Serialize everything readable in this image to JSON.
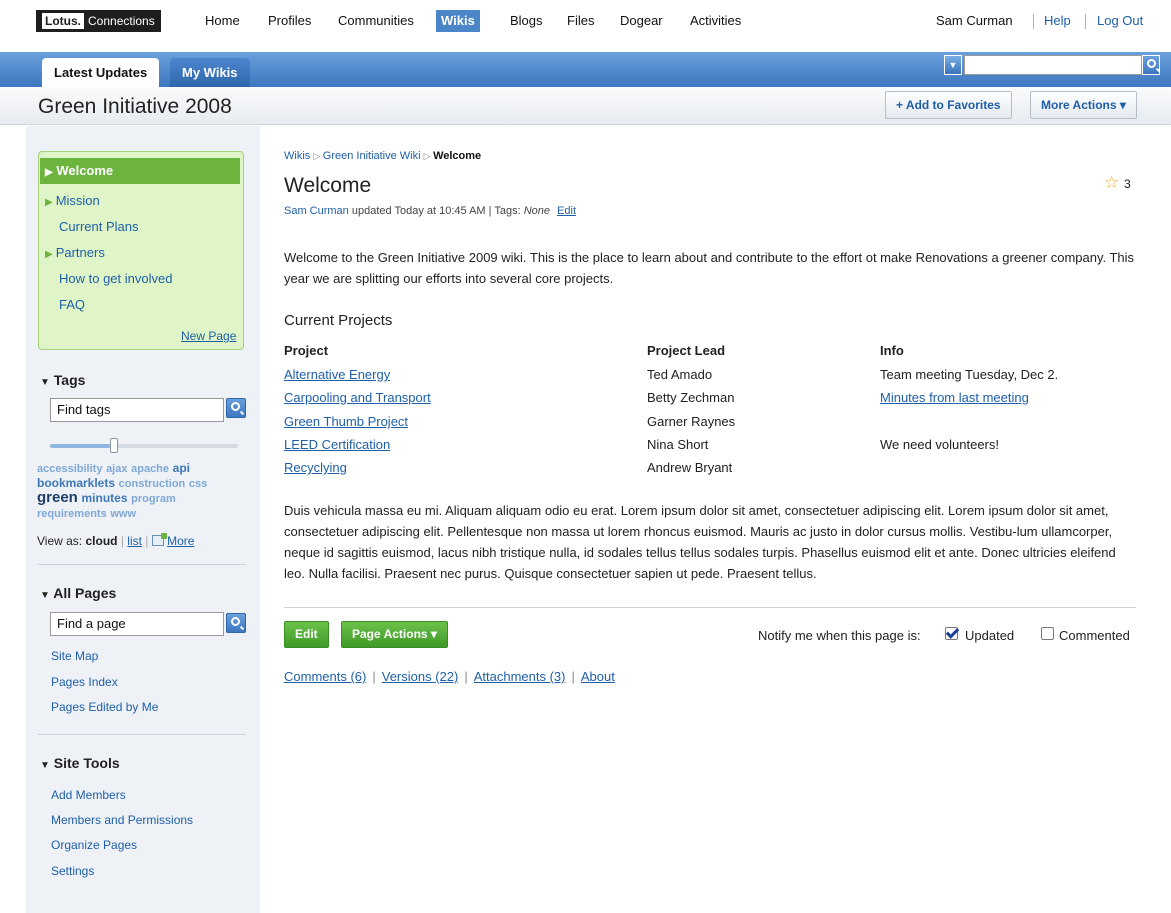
{
  "topnav": {
    "logo_bold": "Lotus.",
    "logo_text": "Connections",
    "items": [
      "Home",
      "Profiles",
      "Communities",
      "Wikis",
      "Blogs",
      "Files",
      "Dogear",
      "Activities"
    ],
    "user": "Sam Curman",
    "help": "Help",
    "logout": "Log Out"
  },
  "tabs": {
    "latest": "Latest Updates",
    "mywikis": "My Wikis"
  },
  "search": {
    "placeholder": "",
    "scope_icon": "chevron-down-icon",
    "button_icon": "search-icon"
  },
  "titlebar": {
    "title": "Green Initiative 2008",
    "add_favorites": "+ Add to Favorites",
    "more_actions": "More Actions ▾"
  },
  "sidebar": {
    "nav": {
      "welcome": "Welcome",
      "items": [
        "Mission",
        "Current Plans",
        "Partners",
        "How to get involved",
        "FAQ"
      ],
      "new_page": "New Page"
    },
    "tags": {
      "title": "Tags",
      "input_value": "Find tags",
      "slider_level": 0.32,
      "cloud": {
        "accessibility": "accessibility",
        "ajax": "ajax",
        "apache": "apache",
        "api": "api",
        "bookmarklets": "bookmarklets",
        "construction": "construction",
        "css": "css",
        "green": "green",
        "minutes": "minutes",
        "program": "program",
        "requirements": "requirements",
        "www": "www"
      },
      "view_as": "View as:",
      "cloud_label": "cloud",
      "list_label": "list",
      "more_label": "More"
    },
    "all_pages": {
      "title": "All Pages",
      "input_value": "Find a page",
      "links": [
        "Site Map",
        "Pages Index",
        "Pages Edited by Me"
      ]
    },
    "site_tools": {
      "title": "Site Tools",
      "links": [
        "Add Members",
        "Members and Permissions",
        "Organize Pages",
        "Settings"
      ]
    }
  },
  "main": {
    "breadcrumb": {
      "wikis": "Wikis",
      "wiki": "Green Initiative Wiki",
      "current": "Welcome"
    },
    "title": "Welcome",
    "star_count": "3",
    "byline": {
      "author": "Sam Curman",
      "text": " updated Today at 10:45 AM | Tags: ",
      "tags": "None",
      "edit": "Edit"
    },
    "intro": "Welcome to the Green Initiative 2009 wiki. This is the place to learn about and contribute to the effort ot make Renovations a greener company.  This year we are splitting our efforts into several core projects.",
    "projects_heading": "Current Projects",
    "table": {
      "headers": [
        "Project",
        "Project Lead",
        "Info"
      ],
      "rows": [
        {
          "project": "Alternative Energy",
          "lead": "Ted Amado",
          "info": "Team meeting Tuesday, Dec 2.",
          "info_link": false
        },
        {
          "project": "Carpooling and Transport",
          "lead": "Betty Zechman",
          "info": "Minutes from last meeting",
          "info_link": true
        },
        {
          "project": "Green Thumb Project",
          "lead": "Garner Raynes",
          "info": "",
          "info_link": false
        },
        {
          "project": "LEED Certification",
          "lead": "Nina Short",
          "info": "We need volunteers!",
          "info_link": false
        },
        {
          "project": "Recyclying",
          "lead": "Andrew Bryant",
          "info": "",
          "info_link": false
        }
      ]
    },
    "lorem": "Duis vehicula massa eu mi. Aliquam aliquam odio eu erat. Lorem ipsum dolor sit amet, consectetuer adipiscing elit. Lorem ipsum dolor sit amet, consectetuer adipiscing elit. Pellentesque non massa ut lorem rhoncus euismod. Mauris ac justo in dolor cursus mollis. Vestibu-lum ullamcorper, neque id sagittis euismod, lacus nibh tristique nulla, id sodales tellus tellus sodales turpis.  Phasellus euismod elit et ante. Donec ultricies eleifend leo. Nulla facilisi. Praesent nec purus. Quisque consectetuer sapien ut pede. Praesent tellus.",
    "edit_button": "Edit",
    "page_actions": "Page Actions ▾",
    "notify_label": "Notify me when this page is:",
    "notify_updated": "Updated",
    "notify_commented": "Commented",
    "notify_updated_checked": true,
    "notify_commented_checked": false,
    "footer_links": [
      "Comments (6)",
      "Versions (22)",
      "Attachments (3)",
      "About"
    ]
  }
}
